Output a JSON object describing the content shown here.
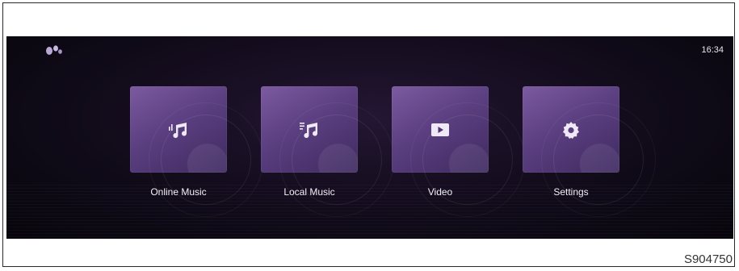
{
  "status_bar": {
    "time": "16:34",
    "logo_icon": "brand-logo-icon"
  },
  "apps": [
    {
      "label": "Online Music",
      "icon": "online-music-icon"
    },
    {
      "label": "Local Music",
      "icon": "local-music-icon"
    },
    {
      "label": "Video",
      "icon": "video-play-icon"
    },
    {
      "label": "Settings",
      "icon": "gear-icon"
    }
  ],
  "figure_code": "S904750",
  "colors": {
    "screen_background": "#110b1a",
    "tile_purple": "#5b3f80",
    "label_text": "#f2eff6"
  }
}
